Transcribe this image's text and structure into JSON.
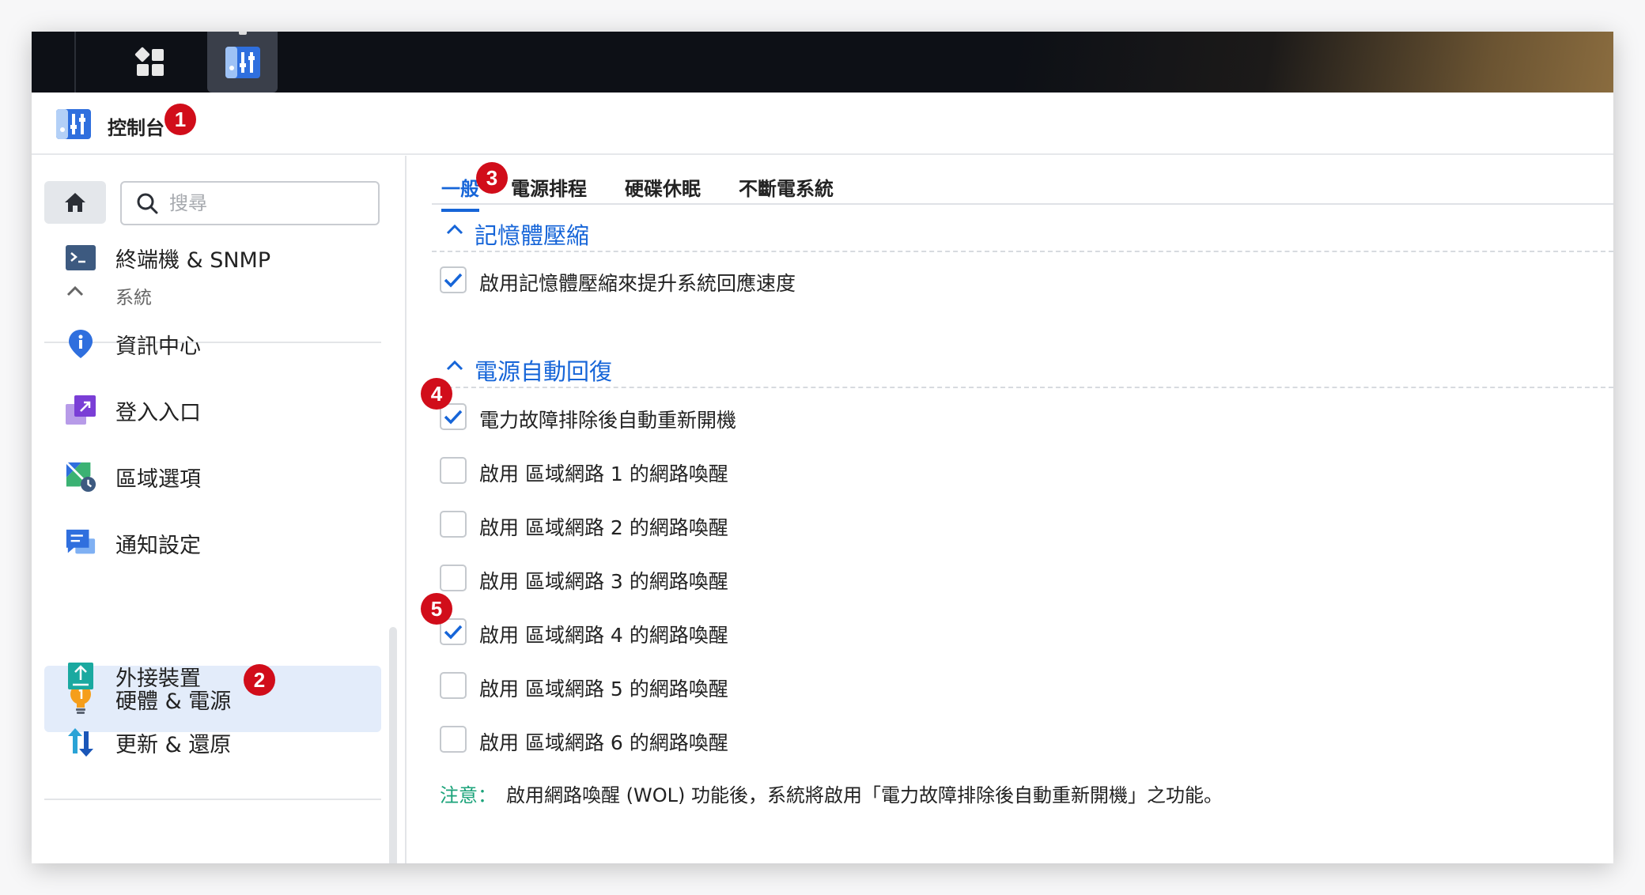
{
  "app": {
    "title": "控制台"
  },
  "annotations": [
    "1",
    "2",
    "3",
    "4",
    "5"
  ],
  "sidebar": {
    "search_placeholder": "搜尋",
    "top_item": {
      "label": "終端機 & SNMP",
      "icon": "terminal-icon"
    },
    "group": {
      "label": "系統"
    },
    "items": [
      {
        "label": "資訊中心",
        "icon": "info-pin-icon"
      },
      {
        "label": "登入入口",
        "icon": "login-portal-icon"
      },
      {
        "label": "區域選項",
        "icon": "regional-options-icon"
      },
      {
        "label": "通知設定",
        "icon": "notification-icon"
      },
      {
        "label": "硬體 & 電源",
        "icon": "bulb-icon",
        "active": true
      },
      {
        "label": "外接裝置",
        "icon": "external-device-icon"
      },
      {
        "label": "更新 & 還原",
        "icon": "update-restore-icon"
      }
    ]
  },
  "tabs": [
    {
      "label": "一般",
      "active": true
    },
    {
      "label": "電源排程"
    },
    {
      "label": "硬碟休眠"
    },
    {
      "label": "不斷電系統"
    }
  ],
  "sections": [
    {
      "title": "記憶體壓縮",
      "options": [
        {
          "label": "啟用記憶體壓縮來提升系統回應速度",
          "checked": true
        }
      ]
    },
    {
      "title": "電源自動回復",
      "options": [
        {
          "label": "電力故障排除後自動重新開機",
          "checked": true
        },
        {
          "label": "啟用 區域網路 1 的網路喚醒",
          "checked": false
        },
        {
          "label": "啟用 區域網路 2 的網路喚醒",
          "checked": false
        },
        {
          "label": "啟用 區域網路 3 的網路喚醒",
          "checked": false
        },
        {
          "label": "啟用 區域網路 4 的網路喚醒",
          "checked": true
        },
        {
          "label": "啟用 區域網路 5 的網路喚醒",
          "checked": false
        },
        {
          "label": "啟用 區域網路 6 的網路喚醒",
          "checked": false
        }
      ]
    }
  ],
  "note": {
    "label": "注意：",
    "text": "啟用網路喚醒 (WOL) 功能後，系統將啟用「電力故障排除後自動重新開機」之功能。"
  },
  "colors": {
    "accent": "#1665d8",
    "badge": "#d10d1a",
    "note_label": "#1ba37a",
    "active_bg": "#e3ecfa"
  }
}
